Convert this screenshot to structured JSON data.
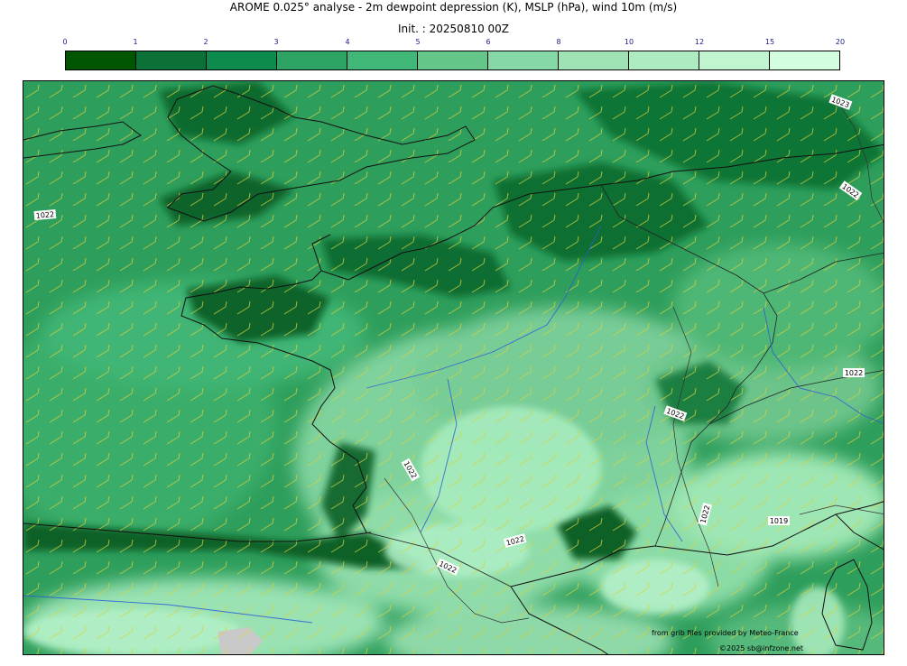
{
  "title": "AROME 0.025° analyse - 2m dewpoint depression (K), MSLP (hPa), wind 10m (m/s)",
  "subtitle": "Init. : 20250810 00Z",
  "colorbar": {
    "ticks": [
      "0",
      "1",
      "2",
      "3",
      "4",
      "5",
      "6",
      "8",
      "10",
      "12",
      "15",
      "20"
    ],
    "colors": [
      "#005500",
      "#0b7136",
      "#0d8b4e",
      "#2ea262",
      "#40b777",
      "#64c688",
      "#86d9a6",
      "#9fe3b4",
      "#adecc0",
      "#bff5d0",
      "#d3ffe0"
    ]
  },
  "isobar_labels": [
    "1023",
    "1022",
    "1022",
    "1022",
    "1022",
    "1022",
    "1022",
    "1022",
    "1022",
    "1019"
  ],
  "credits": {
    "line1": "from grib files provided by Meteo-France",
    "line2": "©2025 sb@infzone.net"
  }
}
